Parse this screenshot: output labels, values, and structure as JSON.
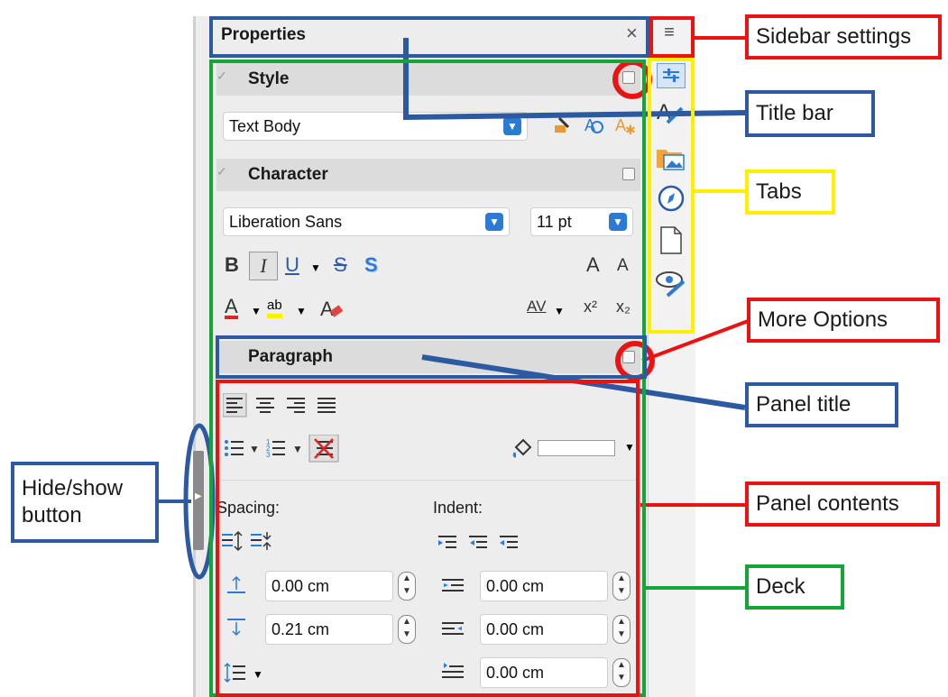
{
  "sidebar": {
    "title": "Properties",
    "close_glyph": "×",
    "menu_glyph": "≡",
    "panels": {
      "style": {
        "title": "Style",
        "paragraph_style": "Text Body"
      },
      "character": {
        "title": "Character",
        "font_name": "Liberation Sans",
        "font_size": "11 pt",
        "bold": "B",
        "italic": "I",
        "underline": "U",
        "strikethrough": "S",
        "shadow": "S",
        "grow": "A",
        "shrink": "A",
        "font_color": "A",
        "highlight": "ab",
        "superscript": "x²",
        "subscript": "x₂",
        "spacing": "AV"
      },
      "paragraph": {
        "title": "Paragraph",
        "spacing_label": "Spacing:",
        "indent_label": "Indent:",
        "above_spacing": "0.00 cm",
        "below_spacing": "0.21 cm",
        "before_indent": "0.00 cm",
        "after_indent": "0.00 cm",
        "first_line_indent": "0.00 cm"
      }
    },
    "tabs": [
      "properties-icon",
      "styles-icon",
      "gallery-icon",
      "navigator-icon",
      "page-icon",
      "style-inspector-icon"
    ]
  },
  "annotations": {
    "sidebar_settings": "Sidebar settings",
    "title_bar": "Title bar",
    "tabs": "Tabs",
    "more_options": "More Options",
    "panel_title": "Panel title",
    "hide_show_l1": "Hide/show",
    "hide_show_l2": "button",
    "panel_contents": "Panel contents",
    "deck": "Deck"
  },
  "colors": {
    "blue": "#2c5aa0",
    "red": "#ee1111",
    "green": "#13a538",
    "yellow": "#ffee00",
    "accent": "#2b7bd6"
  }
}
